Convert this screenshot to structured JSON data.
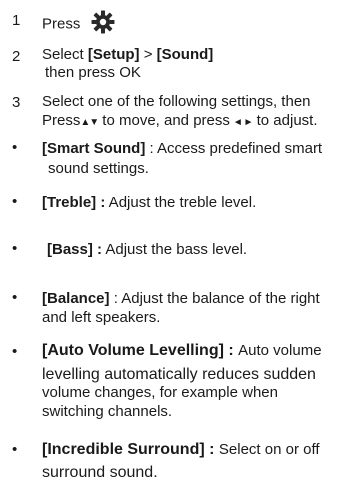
{
  "steps": [
    {
      "number": "1",
      "text": "Press",
      "icon": "gear-icon"
    },
    {
      "number": "2",
      "line1_prefix": "Select ",
      "setup": "[Setup]",
      "sep": " > ",
      "sound": "[Sound]",
      "line2": "then press OK"
    },
    {
      "number": "3",
      "line1": "Select one of the following settings, then",
      "line2_press": "Press",
      "updown": "▲▼",
      "line2_mid": " to move, and press",
      "leftright": "◄ ►",
      "line2_end": " to adjust."
    }
  ],
  "bullet_char": "•",
  "items": [
    {
      "term": "[Smart Sound]",
      "sep": " : ",
      "desc1": "Access predefined smart",
      "desc2": "sound settings."
    },
    {
      "term": "[Treble] :",
      "desc1": " Adjust the treble level."
    },
    {
      "term": "[Bass] :",
      "desc1": " Adjust the bass level."
    },
    {
      "term": "[Balance]",
      "sep": " : ",
      "desc1": "Adjust the balance of the right",
      "desc2": "and left speakers."
    },
    {
      "term": "[Auto Volume Levelling]",
      "sep": " : ",
      "desc1": "Auto volume",
      "desc2": "levelling automatically reduces sudden",
      "desc3": "volume changes, for  example when",
      "desc4": "switching channels."
    },
    {
      "term": "[Incredible Surround]",
      "sep": " : ",
      "desc1": "Select on or off",
      "desc2": "surround sound."
    }
  ]
}
